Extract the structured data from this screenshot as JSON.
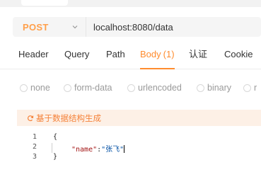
{
  "request": {
    "method": "POST",
    "url": "localhost:8080/data"
  },
  "tabs": [
    {
      "label": "Header"
    },
    {
      "label": "Query"
    },
    {
      "label": "Path"
    },
    {
      "label": "Body",
      "count": "(1)"
    },
    {
      "label": "认证"
    },
    {
      "label": "Cookie"
    }
  ],
  "body_types": [
    "none",
    "form-data",
    "urlencoded",
    "binary",
    "r"
  ],
  "generate_label": "基于数据结构生成",
  "editor": {
    "lines": [
      {
        "number": "1",
        "text": "{"
      },
      {
        "number": "2",
        "key": "\"name\"",
        "sep": ":",
        "value": "\"张飞\""
      },
      {
        "number": "3",
        "text": "}"
      }
    ]
  },
  "colors": {
    "accent": "#ff8c2e",
    "method": "#ff9f4a",
    "generate_bg": "#fdf0e6"
  }
}
